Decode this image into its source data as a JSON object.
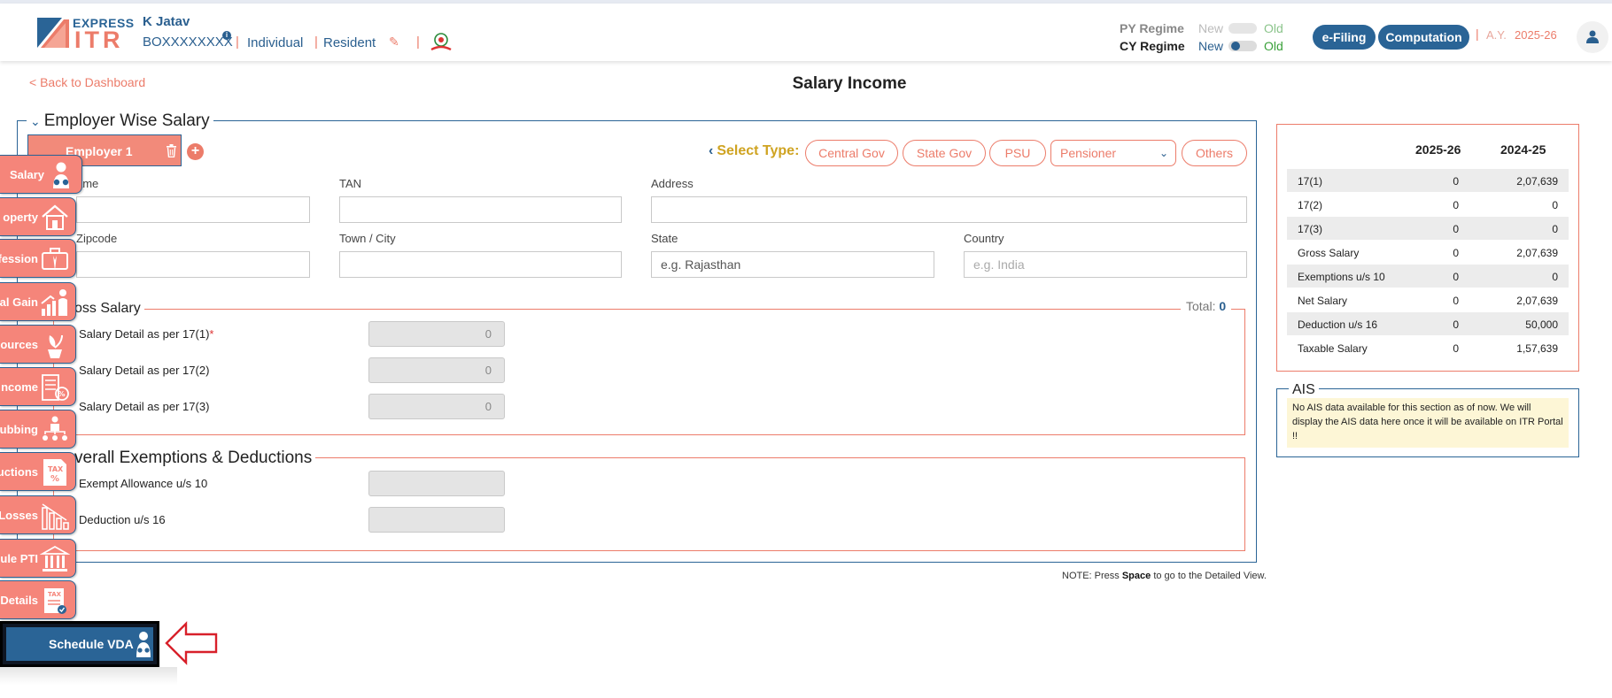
{
  "header": {
    "logo": {
      "top": "EXPRESS",
      "main": "ITR"
    },
    "user_name": "K Jatav",
    "pan": "BOXXXXXXXX",
    "status": "Individual",
    "residency": "Resident",
    "py_regime_label": "PY Regime",
    "cy_regime_label": "CY Regime",
    "new_label": "New",
    "old_label": "Old",
    "efiling_label": "e-Filing",
    "computation_label": "Computation",
    "ay_label": "A.Y.",
    "ay_value": "2025-26"
  },
  "page": {
    "back_label": "< Back to Dashboard",
    "title": "Salary Income"
  },
  "employer": {
    "section_title": "Employer Wise Salary",
    "tab_label": "Employer 1",
    "select_type_label": "Select Type:",
    "type_buttons": [
      "Central Gov",
      "State Gov",
      "PSU",
      "Others"
    ],
    "type_select_value": "Pensioner",
    "fields": {
      "name_label": "Name",
      "name_label_visible": "ame",
      "tan_label": "TAN",
      "address_label": "Address",
      "zipcode_label": "Zipcode",
      "town_label": "Town / City",
      "state_label": "State",
      "country_label": "Country",
      "state_placeholder": "e.g. Rajasthan",
      "country_placeholder": "e.g. India"
    }
  },
  "gross_salary": {
    "title": "Gross Salary",
    "title_visible": "oss Salary",
    "total_label": "Total:",
    "total_value": "0",
    "rows": [
      {
        "label": "Salary Detail as per 17(1)",
        "required": "*",
        "value": "0"
      },
      {
        "label": "Salary Detail as per 17(2)",
        "required": "",
        "value": "0"
      },
      {
        "label": "Salary Detail as per 17(3)",
        "required": "",
        "value": "0"
      }
    ]
  },
  "exemptions": {
    "title": "Overall Exemptions & Deductions",
    "title_visible": "verall Exemptions & Deductions",
    "rows": [
      {
        "label": "Exempt Allowance u/s 10",
        "value": ""
      },
      {
        "label": "Deduction u/s 16",
        "value": ""
      }
    ]
  },
  "note": {
    "prefix": "NOTE: Press ",
    "key": "Space",
    "suffix": " to go to the Detailed View."
  },
  "summary": {
    "col1": "2025-26",
    "col2": "2024-25",
    "rows": [
      {
        "k": "17(1)",
        "v1": "0",
        "v2": "2,07,639"
      },
      {
        "k": "17(2)",
        "v1": "0",
        "v2": "0"
      },
      {
        "k": "17(3)",
        "v1": "0",
        "v2": "0"
      },
      {
        "k": "Gross Salary",
        "v1": "0",
        "v2": "2,07,639"
      },
      {
        "k": "Exemptions u/s 10",
        "v1": "0",
        "v2": "0"
      },
      {
        "k": "Net Salary",
        "v1": "0",
        "v2": "2,07,639"
      },
      {
        "k": "Deduction u/s 16",
        "v1": "0",
        "v2": "50,000"
      },
      {
        "k": "Taxable Salary",
        "v1": "0",
        "v2": "1,57,639"
      }
    ]
  },
  "ais": {
    "title": "AIS",
    "message": "No AIS data available for this section as of now. We will display the AIS data here once it will be available on ITR Portal !!"
  },
  "sidebar": {
    "items": [
      {
        "label": "Salary",
        "icon": "salary-icon"
      },
      {
        "label": "Property",
        "visible": "operty",
        "icon": "house-icon"
      },
      {
        "label": "Profession",
        "visible": "fession",
        "icon": "briefcase-icon"
      },
      {
        "label": "Capital Gain",
        "visible": "al Gain",
        "icon": "growth-icon"
      },
      {
        "label": "Other Sources",
        "visible": "ources",
        "icon": "money-plant-icon"
      },
      {
        "label": "Exempt Income",
        "visible": "ncome",
        "icon": "tax-calc-icon"
      },
      {
        "label": "Clubbing",
        "visible": "ubbing",
        "icon": "hierarchy-icon"
      },
      {
        "label": "Deductions",
        "visible": "uctions",
        "icon": "tax-percent-icon"
      },
      {
        "label": "Losses",
        "visible": "Losses",
        "icon": "declining-chart-icon"
      },
      {
        "label": "Schedule PTI",
        "visible": "ule PTI",
        "icon": "bank-icon"
      },
      {
        "label": "Tax Details",
        "visible": "Details",
        "icon": "tax-doc-icon"
      }
    ],
    "vda_label": "Schedule VDA",
    "vda_icon": "salary-icon"
  },
  "colors": {
    "brand_blue": "#2a6496",
    "brand_coral": "#ec7c6a",
    "ais_bg": "#fdf6d6"
  }
}
